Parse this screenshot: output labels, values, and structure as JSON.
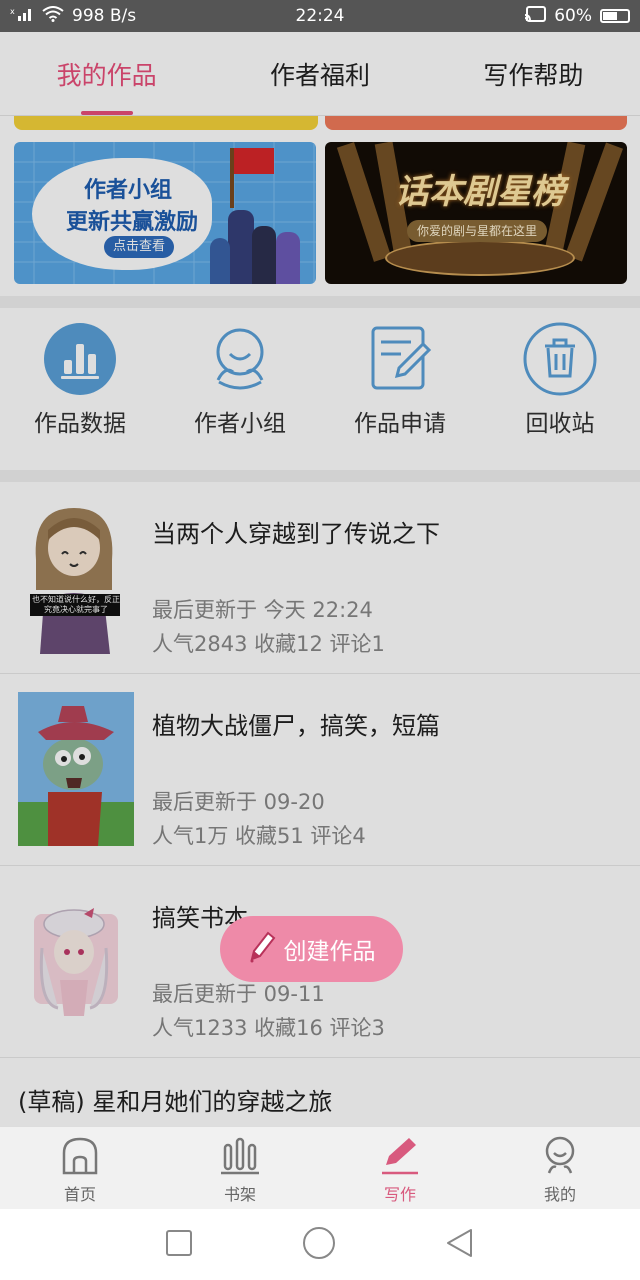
{
  "status_bar": {
    "speed": "998 B/s",
    "time": "22:24",
    "battery": "60%",
    "battery_level": 0.6
  },
  "tabs": [
    {
      "label": "我的作品",
      "active": true
    },
    {
      "label": "作者福利",
      "active": false
    },
    {
      "label": "写作帮助",
      "active": false
    }
  ],
  "banners": {
    "left": {
      "line1": "作者小组",
      "line2": "更新共赢激励",
      "button": "点击查看"
    },
    "right": {
      "title": "话本剧星榜",
      "subtitle": "你爱的剧与星都在这里"
    }
  },
  "quick_actions": [
    {
      "label": "作品数据",
      "icon": "bar-chart-icon"
    },
    {
      "label": "作者小组",
      "icon": "person-icon"
    },
    {
      "label": "作品申请",
      "icon": "edit-document-icon"
    },
    {
      "label": "回收站",
      "icon": "trash-icon"
    }
  ],
  "works": [
    {
      "title": "当两个人穿越到了传说之下",
      "updated": "最后更新于 今天 22:24",
      "stats": "人气2843 收藏12 评论1",
      "cover_caption": "也不知道说什么好，反正究竟决心就完事了"
    },
    {
      "title": "植物大战僵尸，搞笑，短篇",
      "updated": "最后更新于 09-20",
      "stats": "人气1万 收藏51 评论4"
    },
    {
      "title": "搞笑书本",
      "updated": "最后更新于 09-11",
      "stats": "人气1233 收藏16 评论3"
    }
  ],
  "draft": {
    "title": "(草稿) 星和月她们的穿越之旅"
  },
  "fab": {
    "label": "创建作品"
  },
  "bottom_nav": [
    {
      "label": "首页",
      "active": false
    },
    {
      "label": "书架",
      "active": false
    },
    {
      "label": "写作",
      "active": true
    },
    {
      "label": "我的",
      "active": false
    }
  ],
  "colors": {
    "accent": "#e94f7a",
    "icon_blue": "#5aa0d8"
  }
}
